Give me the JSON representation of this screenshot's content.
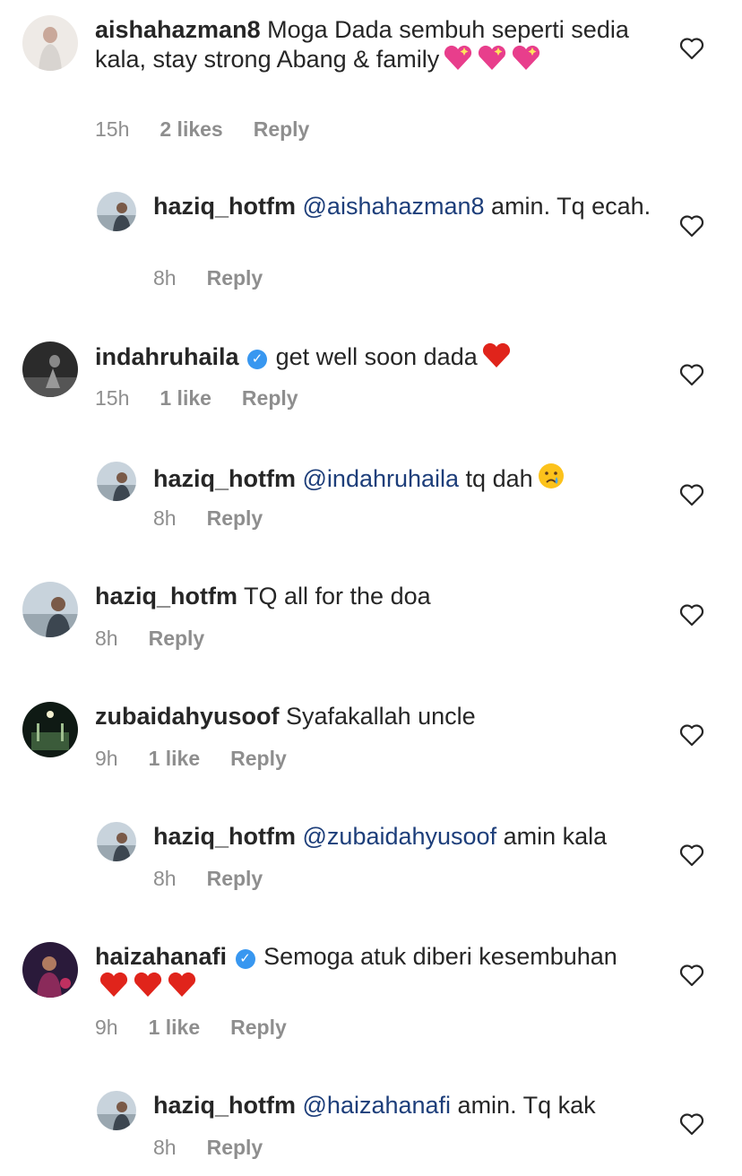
{
  "comments": [
    {
      "username": "aishahazman8",
      "verified": false,
      "mention": "",
      "text": "Moga Dada sembuh seperti sedia kala, stay strong Abang & family",
      "emojis": [
        "sparkling-heart",
        "sparkling-heart",
        "sparkling-heart"
      ],
      "time": "15h",
      "likes": "2 likes",
      "reply": "Reply"
    },
    {
      "username": "haziq_hotfm",
      "verified": false,
      "mention": "@aishahazman8",
      "text": " amin. Tq ecah.",
      "emojis": [],
      "time": "8h",
      "likes": "",
      "reply": "Reply"
    },
    {
      "username": "indahruhaila",
      "verified": true,
      "mention": "",
      "text": "get well soon dada",
      "emojis": [
        "red-heart"
      ],
      "time": "15h",
      "likes": "1 like",
      "reply": "Reply"
    },
    {
      "username": "haziq_hotfm",
      "verified": false,
      "mention": "@indahruhaila",
      "text": " tq dah",
      "emojis": [
        "crying-face"
      ],
      "time": "8h",
      "likes": "",
      "reply": "Reply"
    },
    {
      "username": "haziq_hotfm",
      "verified": false,
      "mention": "",
      "text": "TQ all for the doa",
      "emojis": [],
      "time": "8h",
      "likes": "",
      "reply": "Reply"
    },
    {
      "username": "zubaidahyusoof",
      "verified": false,
      "mention": "",
      "text": "Syafakallah uncle",
      "emojis": [],
      "time": "9h",
      "likes": "1 like",
      "reply": "Reply"
    },
    {
      "username": "haziq_hotfm",
      "verified": false,
      "mention": "@zubaidahyusoof",
      "text": " amin kala",
      "emojis": [],
      "time": "8h",
      "likes": "",
      "reply": "Reply"
    },
    {
      "username": "haizahanafi",
      "verified": true,
      "mention": "",
      "text": "Semoga atuk diberi kesembuhan",
      "emojis": [
        "red-heart",
        "red-heart",
        "red-heart"
      ],
      "time": "9h",
      "likes": "1 like",
      "reply": "Reply"
    },
    {
      "username": "haziq_hotfm",
      "verified": false,
      "mention": "@haizahanafi",
      "text": " amin. Tq kak",
      "emojis": [],
      "time": "8h",
      "likes": "",
      "reply": "Reply"
    }
  ]
}
